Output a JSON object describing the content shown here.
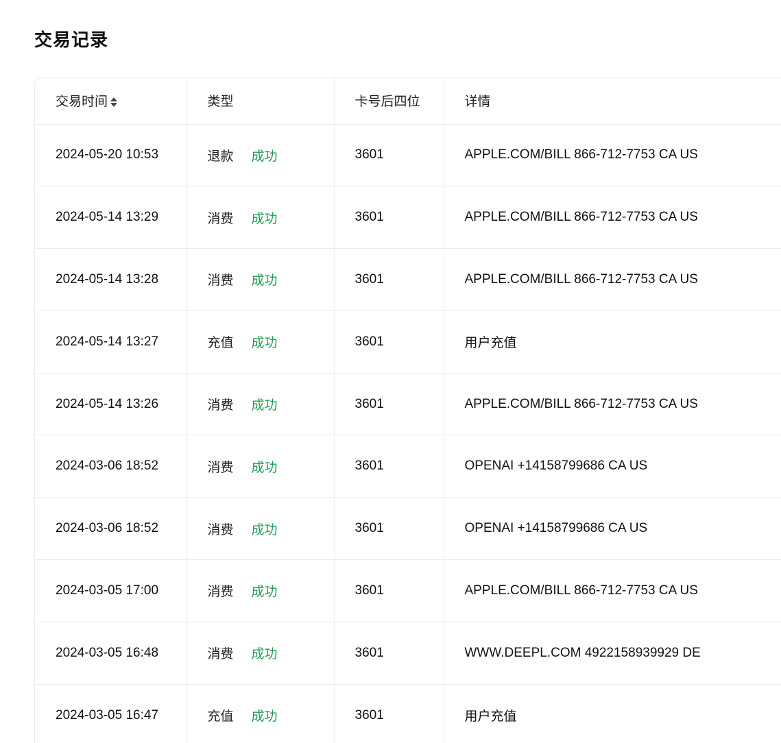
{
  "page": {
    "title": "交易记录"
  },
  "table": {
    "headers": {
      "time": "交易时间",
      "type": "类型",
      "card": "卡号后四位",
      "detail": "详情"
    },
    "rows": [
      {
        "time": "2024-05-20 10:53",
        "type": "退款",
        "status": "成功",
        "card": "3601",
        "detail": "APPLE.COM/BILL 866-712-7753 CA US"
      },
      {
        "time": "2024-05-14 13:29",
        "type": "消费",
        "status": "成功",
        "card": "3601",
        "detail": "APPLE.COM/BILL 866-712-7753 CA US"
      },
      {
        "time": "2024-05-14 13:28",
        "type": "消费",
        "status": "成功",
        "card": "3601",
        "detail": "APPLE.COM/BILL 866-712-7753 CA US"
      },
      {
        "time": "2024-05-14 13:27",
        "type": "充值",
        "status": "成功",
        "card": "3601",
        "detail": "用户充值"
      },
      {
        "time": "2024-05-14 13:26",
        "type": "消费",
        "status": "成功",
        "card": "3601",
        "detail": "APPLE.COM/BILL 866-712-7753 CA US"
      },
      {
        "time": "2024-03-06 18:52",
        "type": "消费",
        "status": "成功",
        "card": "3601",
        "detail": "OPENAI +14158799686 CA US"
      },
      {
        "time": "2024-03-06 18:52",
        "type": "消费",
        "status": "成功",
        "card": "3601",
        "detail": "OPENAI +14158799686 CA US"
      },
      {
        "time": "2024-03-05 17:00",
        "type": "消费",
        "status": "成功",
        "card": "3601",
        "detail": "APPLE.COM/BILL 866-712-7753 CA US"
      },
      {
        "time": "2024-03-05 16:48",
        "type": "消费",
        "status": "成功",
        "card": "3601",
        "detail": "WWW.DEEPL.COM 4922158939929 DE"
      },
      {
        "time": "2024-03-05 16:47",
        "type": "充值",
        "status": "成功",
        "card": "3601",
        "detail": "用户充值"
      }
    ]
  },
  "colors": {
    "success": "#1f9d55",
    "border": "#ececec"
  },
  "icons": {
    "sort": "sort-icon"
  }
}
